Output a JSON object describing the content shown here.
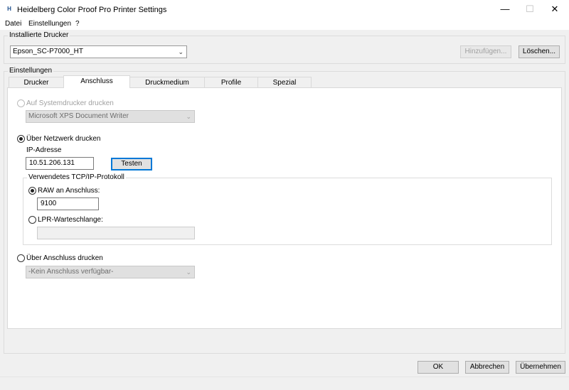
{
  "window": {
    "title": "Heidelberg Color Proof Pro Printer Settings",
    "icon_letter": "H",
    "minimize": "—",
    "maximize": "☐",
    "close": "✕"
  },
  "menu": [
    "Datei",
    "Einstellungen",
    "?"
  ],
  "installed_printers": {
    "group_label": "Installierte Drucker",
    "selected": "Epson_SC-P7000_HT",
    "add_label": "Hinzufügen...",
    "delete_label": "Löschen..."
  },
  "settings": {
    "group_label": "Einstellungen",
    "tabs": [
      "Drucker",
      "Anschluss",
      "Druckmedium",
      "Profile",
      "Spezial"
    ],
    "active_tab": "Anschluss"
  },
  "connection": {
    "system_printer_label": "Auf Systemdrucker drucken",
    "system_printer_value": "Microsoft XPS Document Writer",
    "network_label": "Über Netzwerk drucken",
    "ip_label": "IP-Adresse",
    "ip_value": "10.51.206.131",
    "test_label": "Testen",
    "protocol_group_label": "Verwendetes TCP/IP-Protokoll",
    "raw_label": "RAW an Anschluss:",
    "raw_port": "9100",
    "lpr_label": "LPR-Warteschlange:",
    "lpr_value": "",
    "port_label": "Über Anschluss drucken",
    "port_value": "-Kein Anschluss verfügbar-"
  },
  "footer": {
    "ok_label": "OK",
    "cancel_label": "Abbrechen",
    "apply_label": "Übernehmen"
  }
}
